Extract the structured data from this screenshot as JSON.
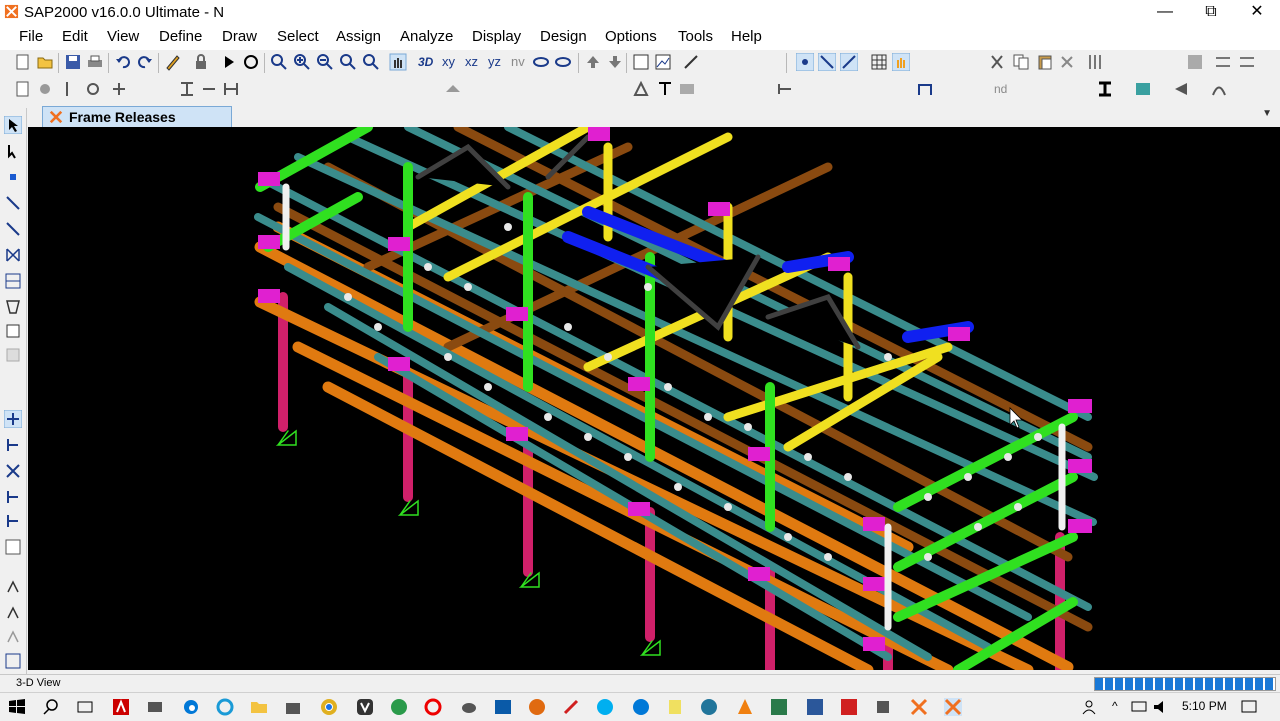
{
  "window": {
    "title": "SAP2000 v16.0.0 Ultimate  - N",
    "minimize": "—",
    "restore": "⧉",
    "close": "✕"
  },
  "menu": [
    "File",
    "Edit",
    "View",
    "Define",
    "Draw",
    "Select",
    "Assign",
    "Analyze",
    "Display",
    "Design",
    "Options",
    "Tools",
    "Help"
  ],
  "toolbar1": {
    "xy": "xy",
    "xz": "xz",
    "yz": "yz",
    "nv": "nv",
    "threed": "3D",
    "icons": [
      "new-model-icon",
      "open-icon",
      "save-icon",
      "print-icon",
      "undo-icon",
      "redo-icon",
      "pencil-icon",
      "lock-icon",
      "run-icon",
      "refresh-icon",
      "zoom-window-icon",
      "zoom-in-icon",
      "zoom-out-icon",
      "zoom-fit-icon",
      "zoom-prev-icon",
      "pan-icon"
    ]
  },
  "toolbar2": {
    "nd": "nd"
  },
  "tab": {
    "label": "Frame Releases",
    "dropdown": "▼"
  },
  "viewport": {
    "background": "#000000"
  },
  "status": {
    "view_label": "3-D View",
    "progress": 1.0
  },
  "taskbar": {
    "time": "5:10 PM"
  },
  "colors": {
    "accent": "#0078d7",
    "tab_bg": "#cfe3f6"
  }
}
